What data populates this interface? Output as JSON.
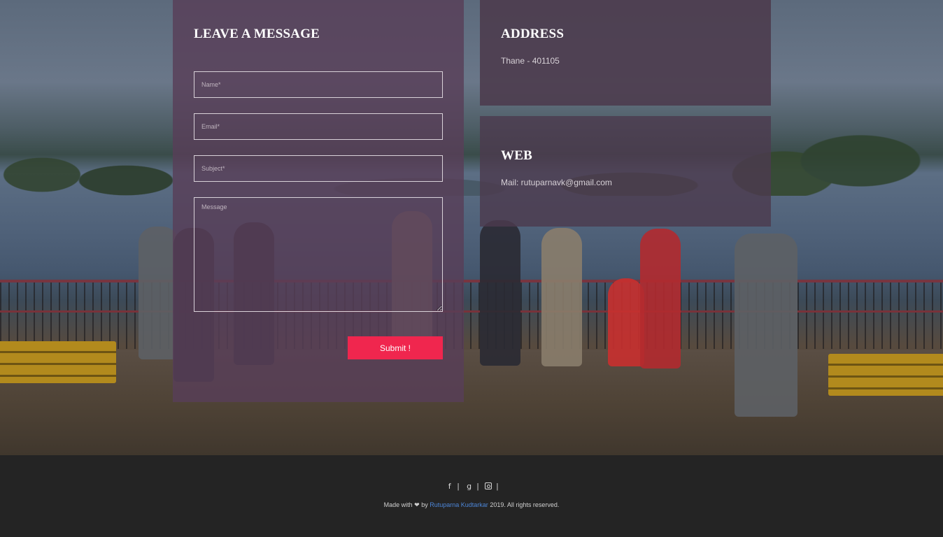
{
  "contact_form": {
    "title": "LEAVE A MESSAGE",
    "name_placeholder": "Name*",
    "email_placeholder": "Email*",
    "subject_placeholder": "Subject*",
    "message_placeholder": "Message",
    "submit_label": "Submit !"
  },
  "address": {
    "title": "ADDRESS",
    "text": "Thane - 401105"
  },
  "web": {
    "title": "WEB",
    "text": "Mail: rutuparnavk@gmail.com"
  },
  "footer": {
    "social": [
      {
        "icon": "facebook-icon",
        "glyph": "f"
      },
      {
        "icon": "google-plus-icon",
        "glyph": "g"
      },
      {
        "icon": "instagram-icon",
        "glyph": ""
      }
    ],
    "separator": "|",
    "credit_prefix": "Made with",
    "credit_by": "by",
    "author_name": "Rutuparna Kudtarkar",
    "credit_suffix": "2019. All rights reserved."
  },
  "colors": {
    "submit": "#f0264e",
    "author_link": "#4c85d6",
    "footer_bg": "#242424",
    "panel_overlay": "#583e58"
  }
}
